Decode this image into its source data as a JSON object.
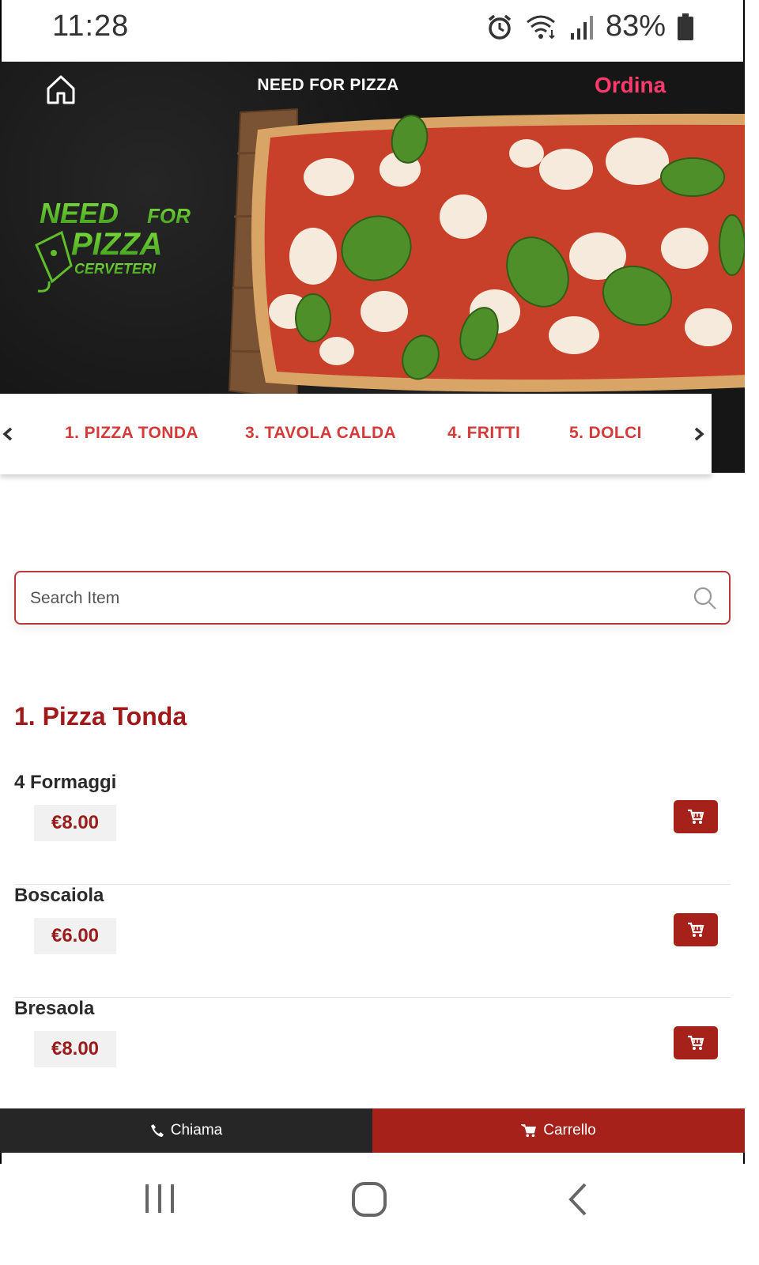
{
  "status_bar": {
    "time": "11:28",
    "battery_percent": "83%",
    "icons": [
      "alarm-icon",
      "wifi-icon",
      "signal-icon",
      "battery-icon"
    ]
  },
  "header": {
    "title": "NEED FOR PIZZA",
    "order_link": "Ordina",
    "order_color": "#ff3b6b",
    "home_icon": "home-icon"
  },
  "logo": {
    "line1": "NEED FOR",
    "line2": "PIZZA",
    "line3": "CERVETERI",
    "color": "#5fbf2a"
  },
  "categories": {
    "items": [
      "1. PIZZA TONDA",
      "3. TAVOLA CALDA",
      "4. FRITTI",
      "5. DOLCI"
    ],
    "color": "#d33a3a"
  },
  "search": {
    "placeholder": "Search Item",
    "value": ""
  },
  "menu": {
    "section_title": "1. Pizza Tonda",
    "items": [
      {
        "name": "4 Formaggi",
        "price": "€8.00"
      },
      {
        "name": "Boscaiola",
        "price": "€6.00"
      },
      {
        "name": "Bresaola",
        "price": "€8.00"
      }
    ]
  },
  "bottom_bar": {
    "call_label": "Chiama",
    "cart_label": "Carrello"
  },
  "colors": {
    "accent": "#a5211a",
    "title_red": "#a01a1a"
  }
}
